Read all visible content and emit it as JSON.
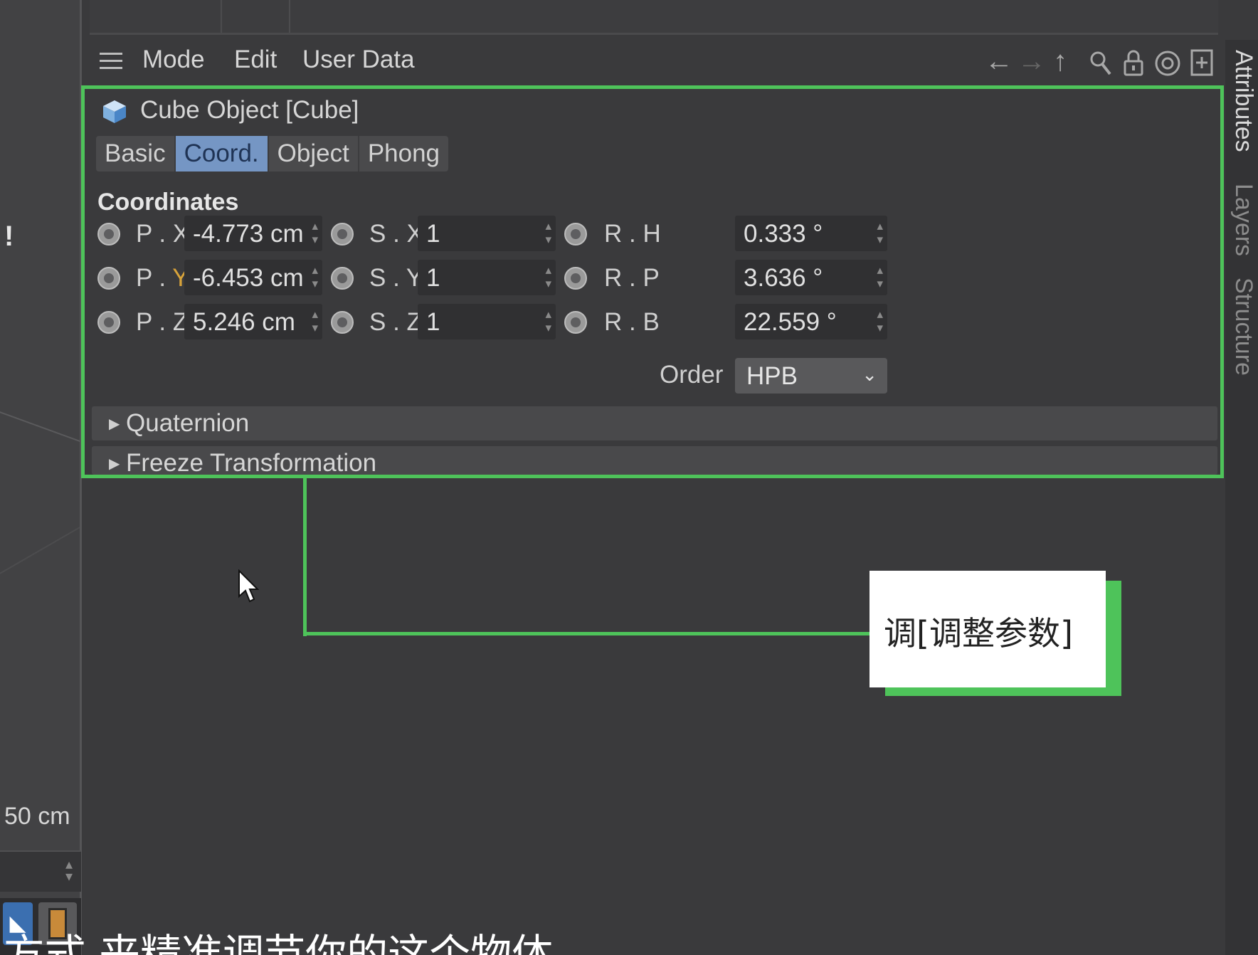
{
  "viewport": {
    "warning_text": "!",
    "distance_label": "50 cm"
  },
  "menu": {
    "items": [
      "Mode",
      "Edit",
      "User Data"
    ],
    "icons": [
      "hamburger-icon",
      "arrow-left-icon",
      "arrow-right-icon",
      "arrow-up-icon",
      "search-icon",
      "lock-icon",
      "target-icon",
      "new-panel-icon"
    ]
  },
  "panel": {
    "title": "Cube Object [Cube]",
    "tabs": [
      "Basic",
      "Coord.",
      "Object",
      "Phong"
    ],
    "active_tab": "Coord.",
    "section_title": "Coordinates",
    "position": {
      "x_label": "P . X",
      "x_value": "-4.773 cm",
      "y_label_prefix": "P . ",
      "y_label_axis": "Y",
      "y_value": "-6.453 cm",
      "z_label": "P . Z",
      "z_value": "5.246 cm"
    },
    "scale": {
      "x_label": "S . X",
      "x_value": "1",
      "y_label": "S . Y",
      "y_value": "1",
      "z_label": "S . Z",
      "z_value": "1"
    },
    "rotation": {
      "h_label": "R . H",
      "h_value": "0.333 °",
      "p_label": "R . P",
      "p_value": "3.636 °",
      "b_label": "R . B",
      "b_value": "22.559 °"
    },
    "order_label": "Order",
    "order_value": "HPB",
    "groups": [
      "Quaternion",
      "Freeze Transformation"
    ]
  },
  "side_tabs": [
    "Attributes",
    "Layers",
    "Structure"
  ],
  "callout": {
    "text": "调[调整参数]"
  },
  "subtitle": "]方式 来精准调节你的这个物体",
  "colors": {
    "highlight": "#4ec35a",
    "active_tab": "#7596c4",
    "axis_y": "#d8a33a"
  }
}
